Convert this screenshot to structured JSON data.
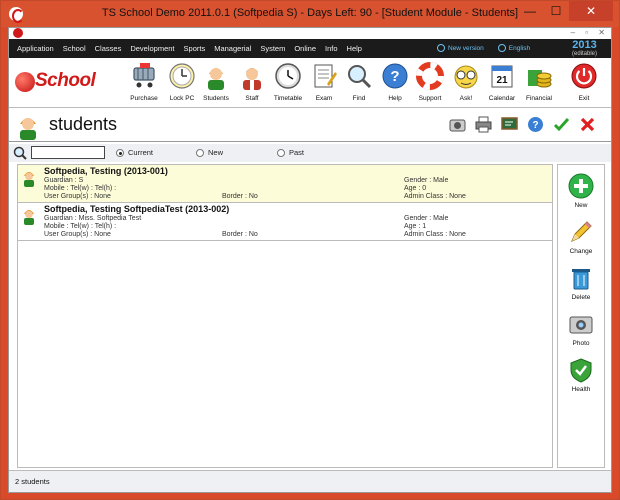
{
  "window": {
    "title": "TS School Demo 2011.0.1 (Softpedia S) - Days Left: 90 - [Student Module - Students]",
    "min_glyph": "—",
    "max_glyph": "☐",
    "close_glyph": "✕"
  },
  "menubar": {
    "items": [
      "Application",
      "School",
      "Classes",
      "Development",
      "Sports",
      "Managerial",
      "System",
      "Online",
      "Info",
      "Help"
    ],
    "new_version": "New version",
    "language": "English",
    "year": "2013",
    "year_note": "(editable)"
  },
  "toolbar": {
    "logo_text": "School",
    "tools": [
      {
        "label": "Purchase",
        "icon": "cart-icon"
      },
      {
        "label": "Lock PC",
        "icon": "lock-icon"
      },
      {
        "label": "Students",
        "icon": "student-icon"
      },
      {
        "label": "Staff",
        "icon": "staff-icon"
      },
      {
        "label": "Timetable",
        "icon": "clock-icon"
      },
      {
        "label": "Exam",
        "icon": "exam-icon"
      },
      {
        "label": "Find",
        "icon": "magnifier-icon"
      },
      {
        "label": "Help",
        "icon": "help-icon"
      },
      {
        "label": "Support",
        "icon": "lifebuoy-icon"
      },
      {
        "label": "Ask!",
        "icon": "ask-icon"
      },
      {
        "label": "Calendar",
        "icon": "calendar-icon"
      },
      {
        "label": "Financial",
        "icon": "coins-icon"
      },
      {
        "label": "Exit",
        "icon": "power-icon"
      }
    ],
    "calendar_day": "21"
  },
  "students_header": {
    "title": "students"
  },
  "filter": {
    "search_value": "",
    "options": [
      {
        "label": "Current",
        "selected": true
      },
      {
        "label": "New",
        "selected": false
      },
      {
        "label": "Past",
        "selected": false
      }
    ]
  },
  "students": [
    {
      "name": "Softpedia, Testing  (2013-001)",
      "guardian": "Guardian :    S",
      "contact": "Mobile :     Tel(w) :     Tel(h) :",
      "groups": "User Group(s) : None",
      "border": "Border : No",
      "gender": "Gender : Male",
      "age": "Age : 0",
      "admin_class": "Admin Class : None",
      "selected": true
    },
    {
      "name": "Softpedia, Testing SoftpediaTest (2013-002)",
      "guardian": "Guardian : Miss.  Softpedia Test",
      "contact": "Mobile :     Tel(w) :     Tel(h) :",
      "groups": "User Group(s) : None",
      "border": "Border : No",
      "gender": "Gender : Male",
      "age": "Age : 1",
      "admin_class": "Admin Class : None",
      "selected": false
    }
  ],
  "side_actions": [
    {
      "label": "New",
      "icon": "plus-icon"
    },
    {
      "label": "Change",
      "icon": "pencil-icon"
    },
    {
      "label": "Delete",
      "icon": "trash-icon"
    },
    {
      "label": "Photo",
      "icon": "camera-icon"
    },
    {
      "label": "Health",
      "icon": "shield-check-icon"
    }
  ],
  "status": {
    "text": "2 students"
  },
  "colors": {
    "title_bar": "#d9522f",
    "menubar": "#1b1b1b",
    "accent_link": "#6cc3f0",
    "selected_row": "#fdfcd9",
    "brand_red": "#d11a1a"
  }
}
